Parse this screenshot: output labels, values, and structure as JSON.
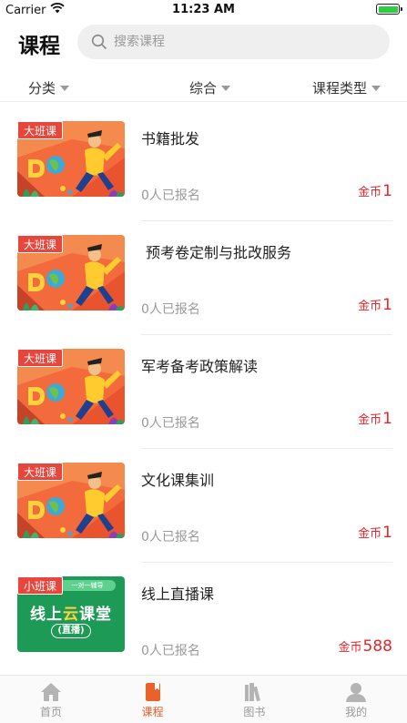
{
  "status_bar": {
    "carrier": "Carrier",
    "time": "11:23 AM"
  },
  "header": {
    "title": "课程",
    "search_placeholder": "搜索课程"
  },
  "filters": [
    {
      "label": "分类"
    },
    {
      "label": "综合"
    },
    {
      "label": "课程类型"
    }
  ],
  "courses": [
    {
      "badge": "大班课",
      "title": "书籍批发",
      "enrolled": "0人已报名",
      "price_unit": "金币",
      "price": "1",
      "thumb": "illustration"
    },
    {
      "badge": "大班课",
      "title": "预考卷定制与批改服务",
      "enrolled": "0人已报名",
      "price_unit": "金币",
      "price": "1",
      "thumb": "illustration"
    },
    {
      "badge": "大班课",
      "title": "军考备考政策解读",
      "enrolled": "0人已报名",
      "price_unit": "金币",
      "price": "1",
      "thumb": "illustration"
    },
    {
      "badge": "大班课",
      "title": "文化课集训",
      "enrolled": "0人已报名",
      "price_unit": "金币",
      "price": "1",
      "thumb": "illustration"
    },
    {
      "badge": "小班课",
      "title": "线上直播课",
      "enrolled": "0人已报名",
      "price_unit": "金币",
      "price": "588",
      "thumb": "live",
      "thumb_text": {
        "strip": "一对一辅导",
        "main_a": "线上",
        "main_hl": "云",
        "main_b": "课堂",
        "sub": "(直播)"
      }
    }
  ],
  "tabs": [
    {
      "label": "首页",
      "icon": "home-icon",
      "active": false
    },
    {
      "label": "课程",
      "icon": "book-icon",
      "active": true
    },
    {
      "label": "图书",
      "icon": "library-icon",
      "active": false
    },
    {
      "label": "我的",
      "icon": "user-icon",
      "active": false
    }
  ],
  "colors": {
    "accent": "#e8622a",
    "price": "#e8252a",
    "badge": "#e8453c",
    "live_green": "#1d9a56"
  }
}
